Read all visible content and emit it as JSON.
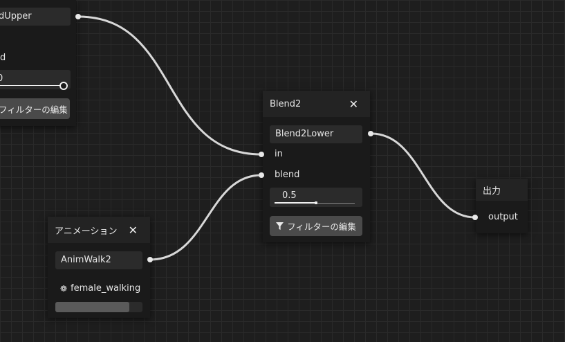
{
  "colors": {
    "background": "#1e1e1e",
    "grid": "#2a2a2a",
    "node_body": "#1a1a1a",
    "node_header": "#232323",
    "field": "#2b2b2b",
    "button": "#4a4a4a",
    "wire": "#d8d8d8"
  },
  "node_upper": {
    "name": "dUpper",
    "port_label": "d",
    "slider_value": "0",
    "filter_label": "フィルターの編集",
    "filter_icon": "filter-icon"
  },
  "node_blend2": {
    "title": "Blend2",
    "close_icon": "close-icon",
    "name": "Blend2Lower",
    "port_in": "in",
    "port_blend": "blend",
    "slider_value": "0.5",
    "slider_level": 0.5,
    "filter_label": "フィルターの編集",
    "filter_icon": "filter-icon"
  },
  "node_animation": {
    "title": "アニメーション",
    "close_icon": "close-icon",
    "name": "AnimWalk2",
    "clip_icon": "film-reel-icon",
    "clip": "female_walking",
    "progress": 0.85
  },
  "node_output": {
    "title": "出力",
    "port": "output"
  }
}
